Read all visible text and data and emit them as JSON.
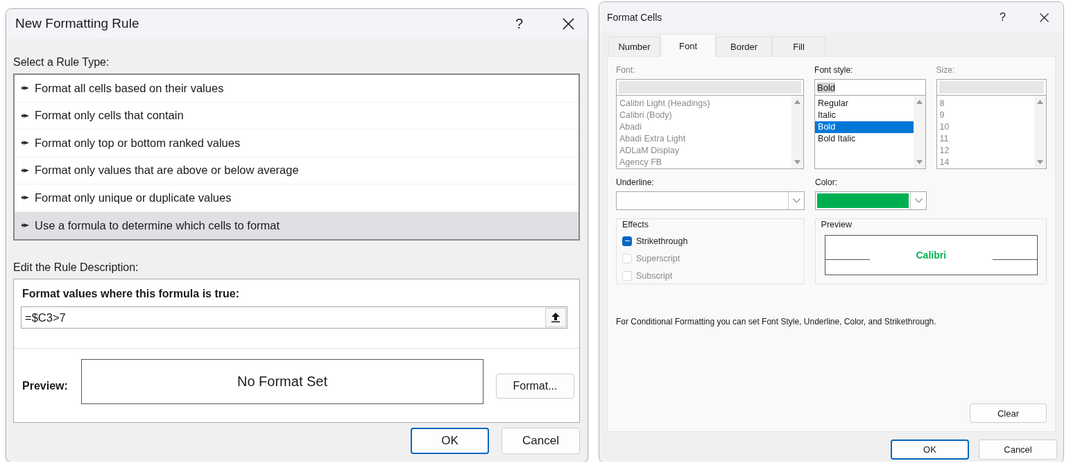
{
  "rule_dialog": {
    "title": "New Formatting Rule",
    "help": "?",
    "select_label": "Select a Rule Type:",
    "rule_types": [
      {
        "label": "Format all cells based on their values",
        "selected": false
      },
      {
        "label": "Format only cells that contain",
        "selected": false
      },
      {
        "label": "Format only top or bottom ranked values",
        "selected": false
      },
      {
        "label": "Format only values that are above or below average",
        "selected": false
      },
      {
        "label": "Format only unique or duplicate values",
        "selected": false
      },
      {
        "label": "Use a formula to determine which cells to format",
        "selected": true
      }
    ],
    "edit_label": "Edit the Rule Description:",
    "formula_label": "Format values where this formula is true:",
    "formula": {
      "value": "=$C3>7"
    },
    "preview_label": "Preview:",
    "preview_text": "No Format Set",
    "format_button": "Format...",
    "buttons": [
      {
        "label": "OK",
        "default": true
      },
      {
        "label": "Cancel",
        "default": false
      }
    ]
  },
  "format_cells": {
    "title": "Format Cells",
    "help": "?",
    "tabs": [
      {
        "label": "Number",
        "selected": false
      },
      {
        "label": "Font",
        "selected": true
      },
      {
        "label": "Border",
        "selected": false
      },
      {
        "label": "Fill",
        "selected": false
      }
    ],
    "font": {
      "label": "Font:",
      "disabled": true,
      "items": [
        "Calibri Light (Headings)",
        "Calibri (Body)",
        "Abadi",
        "Abadi Extra Light",
        "ADLaM Display",
        "Agency FB"
      ]
    },
    "font_style": {
      "label": "Font style:",
      "value": "Bold",
      "text_selected": true,
      "items": [
        {
          "label": "Regular",
          "selected": false
        },
        {
          "label": "Italic",
          "selected": false
        },
        {
          "label": "Bold",
          "selected": true
        },
        {
          "label": "Bold Italic",
          "selected": false
        }
      ]
    },
    "size": {
      "label": "Size:",
      "disabled": true,
      "items": [
        "8",
        "9",
        "10",
        "11",
        "12",
        "14"
      ]
    },
    "underline": {
      "label": "Underline:"
    },
    "color": {
      "label": "Color:",
      "color": "#00b050"
    },
    "effects": {
      "title": "Effects",
      "options": [
        {
          "label": "Strikethrough",
          "indeterminate": true,
          "disabled": false
        },
        {
          "label": "Superscript",
          "indeterminate": false,
          "disabled": true
        },
        {
          "label": "Subscript",
          "indeterminate": false,
          "disabled": true
        }
      ]
    },
    "preview": {
      "title": "Preview",
      "sample": "Calibri"
    },
    "note": "For Conditional Formatting you can set Font Style, Underline, Color, and Strikethrough.",
    "clear_button": "Clear",
    "buttons": [
      {
        "label": "OK",
        "default": true
      },
      {
        "label": "Cancel",
        "default": false
      }
    ]
  }
}
